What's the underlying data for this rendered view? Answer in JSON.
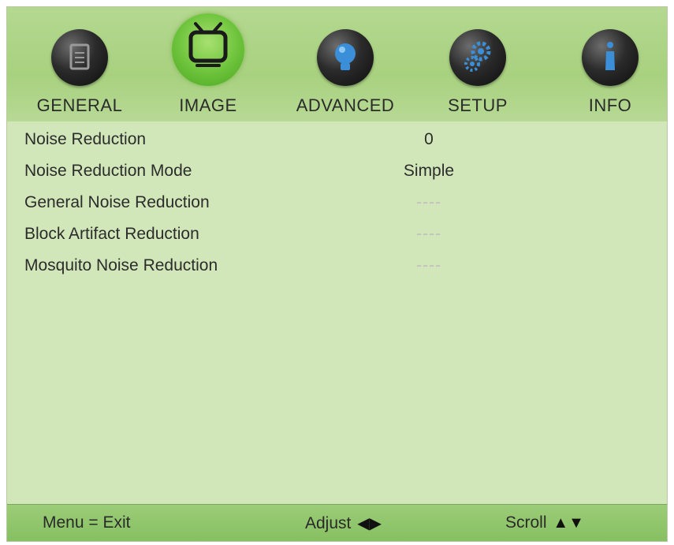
{
  "tabs": [
    {
      "label": "GENERAL",
      "icon": "document-icon",
      "selected": false
    },
    {
      "label": "IMAGE",
      "icon": "tv-icon",
      "selected": true
    },
    {
      "label": "ADVANCED",
      "icon": "lightbulb-icon",
      "selected": false
    },
    {
      "label": "SETUP",
      "icon": "gears-icon",
      "selected": false
    },
    {
      "label": "INFO",
      "icon": "info-icon",
      "selected": false
    }
  ],
  "rows": [
    {
      "label": "Noise Reduction",
      "value": "0",
      "enabled": true
    },
    {
      "label": "Noise Reduction Mode",
      "value": "Simple",
      "enabled": true
    },
    {
      "label": "General Noise Reduction",
      "value": "----",
      "enabled": false
    },
    {
      "label": "Block Artifact Reduction",
      "value": "----",
      "enabled": false
    },
    {
      "label": "Mosquito Noise Reduction",
      "value": "----",
      "enabled": false
    }
  ],
  "footer": {
    "menu_hint": "Menu = Exit",
    "adjust_hint": "Adjust",
    "adjust_arrows": "◀▶",
    "scroll_hint": "Scroll",
    "scroll_arrows": "▲▼"
  },
  "colors": {
    "panel": "#d2e7b9",
    "tab_bar": "#a8d17f",
    "selected_tab": "#6cc33a",
    "footer": "#86c061",
    "disabled_value": "#bfbfbf"
  }
}
